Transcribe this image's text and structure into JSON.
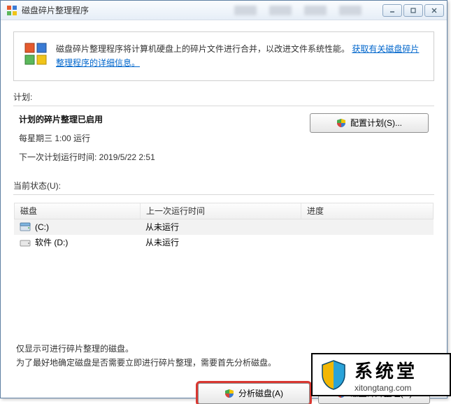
{
  "window": {
    "title": "磁盘碎片整理程序"
  },
  "info": {
    "text_prefix": "磁盘碎片整理程序将计算机硬盘上的碎片文件进行合并，以改进文件系统性能。",
    "link_text": "获取有关磁盘碎片整理程序的详细信息。"
  },
  "labels": {
    "schedule": "计划:",
    "current_status": "当前状态(U):"
  },
  "schedule": {
    "enabled_line": "计划的碎片整理已启用",
    "run_line": "每星期三 1:00 运行",
    "next_run_line": "下一次计划运行时间: 2019/5/22 2:51",
    "config_button": "配置计划(S)..."
  },
  "table": {
    "headers": {
      "disk": "磁盘",
      "last_run": "上一次运行时间",
      "progress": "进度"
    },
    "rows": [
      {
        "icon": "drive-c",
        "name": "(C:)",
        "last_run": "从未运行",
        "progress": ""
      },
      {
        "icon": "drive-d",
        "name": "软件 (D:)",
        "last_run": "从未运行",
        "progress": ""
      }
    ]
  },
  "footer": {
    "line1": "仅显示可进行碎片整理的磁盘。",
    "line2": "为了最好地确定磁盘是否需要立即进行碎片整理，需要首先分析磁盘。"
  },
  "actions": {
    "analyze": "分析磁盘(A)",
    "defrag": "磁盘碎片整理(D)"
  },
  "watermark": {
    "brand": "系统堂",
    "url": "xitongtang.com"
  }
}
